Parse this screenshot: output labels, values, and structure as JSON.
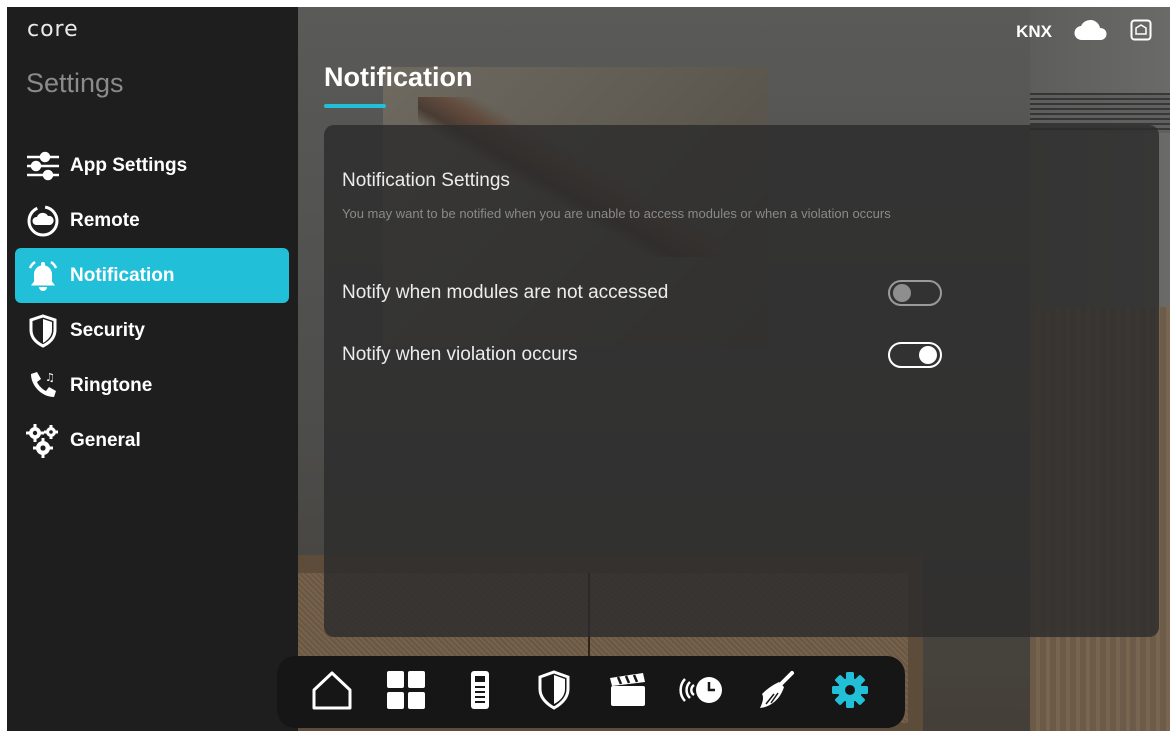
{
  "brand": "core",
  "sidebar": {
    "title": "Settings",
    "items": [
      {
        "label": "App Settings",
        "icon": "sliders-icon",
        "active": false
      },
      {
        "label": "Remote",
        "icon": "cloud-circle-icon",
        "active": false
      },
      {
        "label": "Notification",
        "icon": "bell-icon",
        "active": true
      },
      {
        "label": "Security",
        "icon": "shield-icon",
        "active": false
      },
      {
        "label": "Ringtone",
        "icon": "phone-music-icon",
        "active": false
      },
      {
        "label": "General",
        "icon": "gears-icon",
        "active": false
      }
    ]
  },
  "page": {
    "title": "Notification"
  },
  "card": {
    "heading": "Notification Settings",
    "description": "You may want to be notified when you are unable to access modules or when a violation occurs",
    "options": [
      {
        "label": "Notify when modules are not accessed",
        "enabled": false
      },
      {
        "label": "Notify when violation occurs",
        "enabled": true
      }
    ]
  },
  "status": {
    "protocol": "KNX",
    "icons": [
      "cloud-icon",
      "gateway-icon"
    ]
  },
  "dock": {
    "items": [
      "home-icon",
      "grid-icon",
      "intercom-icon",
      "shield-icon",
      "scene-clapper-icon",
      "schedule-icon",
      "cleaning-icon",
      "settings-gear-icon"
    ],
    "active": "settings-gear-icon"
  },
  "colors": {
    "accent": "#22c0d8",
    "sidebar_bg": "#1e1e1e",
    "card_bg": "#2c2c2c"
  }
}
